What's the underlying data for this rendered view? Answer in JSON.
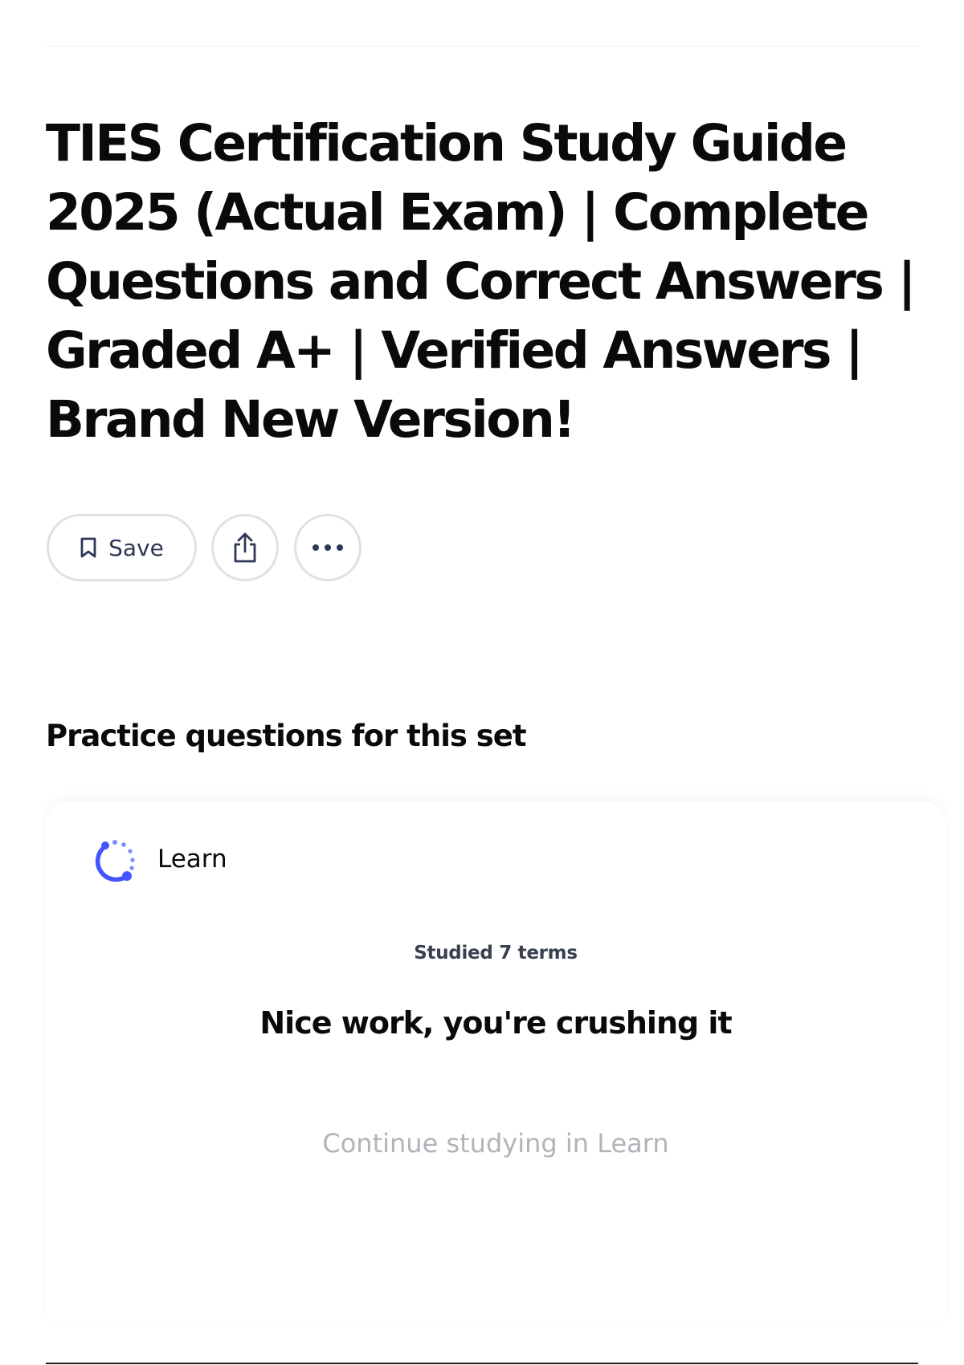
{
  "header": {
    "title": "TIES Certification Study Guide 2025 (Actual Exam) | Complete Questions and Correct Answers | Graded A+ | Verified Answers | Brand New Version!"
  },
  "actions": {
    "save_label": "Save",
    "save_icon": "bookmark-icon",
    "share_icon": "share-icon",
    "more_icon": "more-horizontal-icon"
  },
  "practice": {
    "heading": "Practice questions for this set",
    "learn": {
      "label": "Learn",
      "icon": "learn-progress-icon",
      "icon_color": "#4255ff"
    },
    "studied_text": "Studied 7 terms",
    "encouragement": "Nice work, you're crushing it",
    "continue_label": "Continue studying in Learn"
  },
  "colors": {
    "text_primary": "#0a0a0a",
    "text_secondary": "#2e3856",
    "muted": "#b1b3b8",
    "border": "#dfe1e8",
    "accent": "#4255ff"
  }
}
